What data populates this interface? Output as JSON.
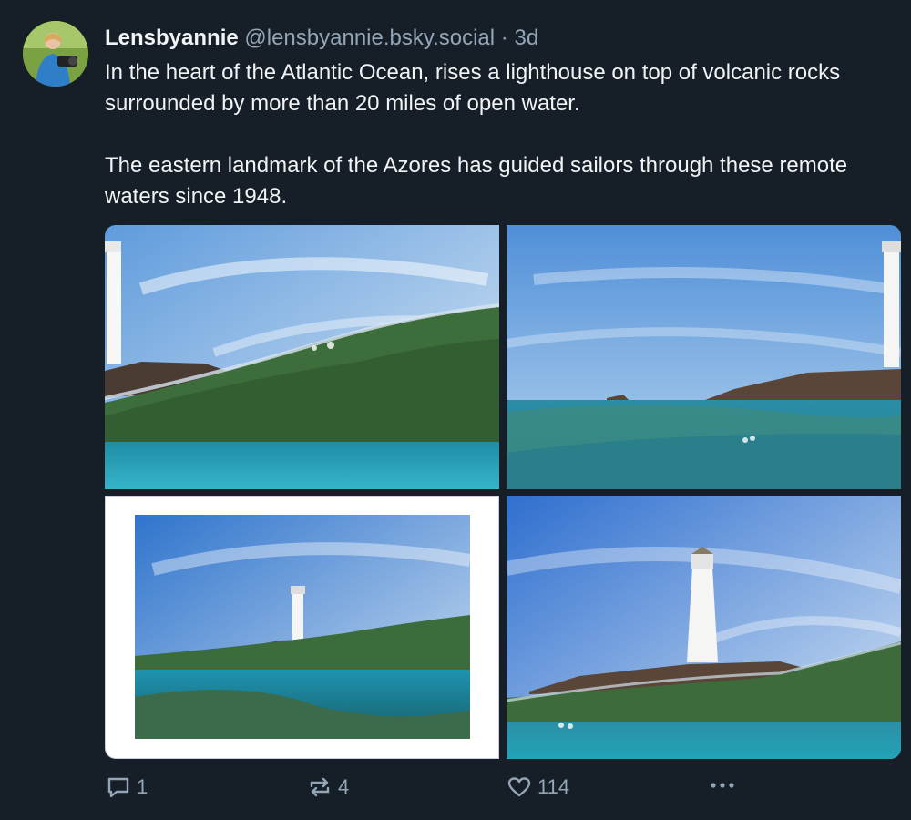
{
  "post": {
    "author_name": "Lensbyannie",
    "author_handle": "@lensbyannie.bsky.social",
    "separator": "·",
    "timestamp": "3d",
    "paragraphs": [
      "In the heart of the Atlantic Ocean, rises a lighthouse on top of volcanic rocks surrounded by more than 20 miles of open water.",
      "The eastern landmark of the Azores has guided sailors through these remote waters since 1948."
    ],
    "images": [
      {
        "name": "photo-1",
        "icon": "lighthouse-split-view-photo"
      },
      {
        "name": "photo-2",
        "icon": "lighthouse-split-view-photo"
      },
      {
        "name": "photo-3",
        "icon": "framed-lighthouse-photo"
      },
      {
        "name": "photo-4",
        "icon": "lighthouse-split-view-photo"
      }
    ]
  },
  "actions": {
    "reply_count": "1",
    "repost_count": "4",
    "like_count": "114",
    "reply_icon": "speech-bubble-icon",
    "repost_icon": "repost-arrows-icon",
    "like_icon": "heart-icon",
    "more_icon": "ellipsis-icon"
  },
  "colors": {
    "background": "#161e27",
    "text": "#f1f3f5",
    "muted": "#93a5b7"
  }
}
